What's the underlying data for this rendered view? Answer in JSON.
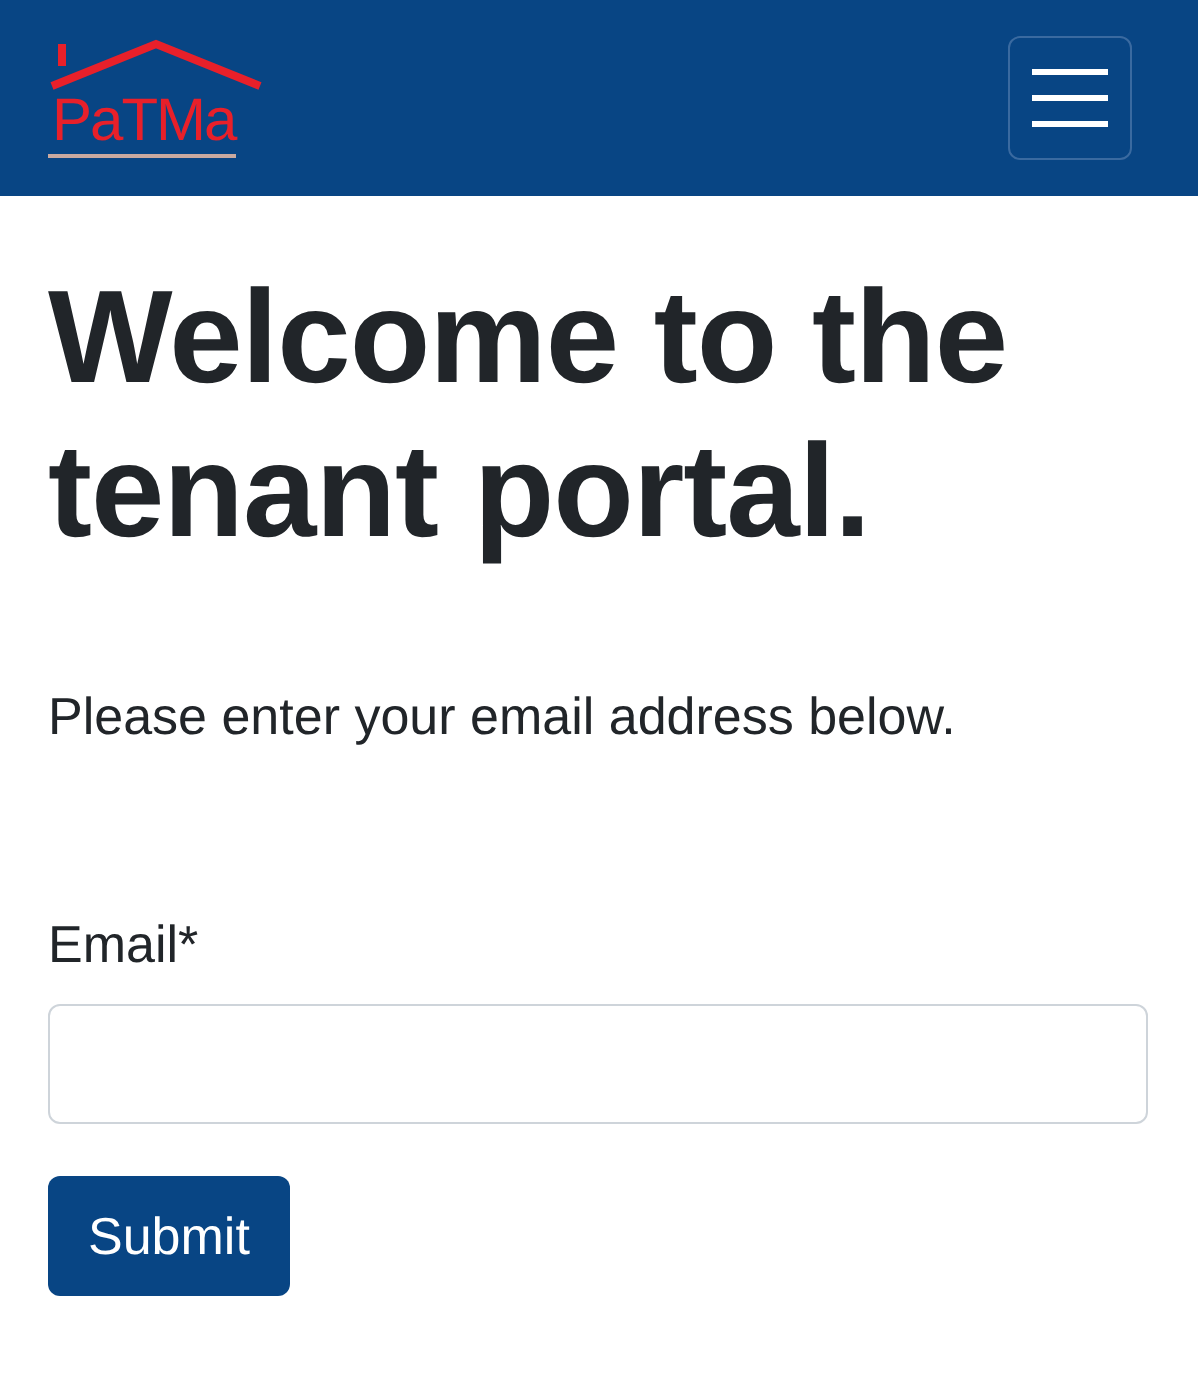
{
  "header": {
    "logo_text": "PaTMa"
  },
  "heading": "Welcome to the tenant portal.",
  "intro": "Please enter your email address below.",
  "form": {
    "email_label": "Email*",
    "submit": "Submit"
  }
}
